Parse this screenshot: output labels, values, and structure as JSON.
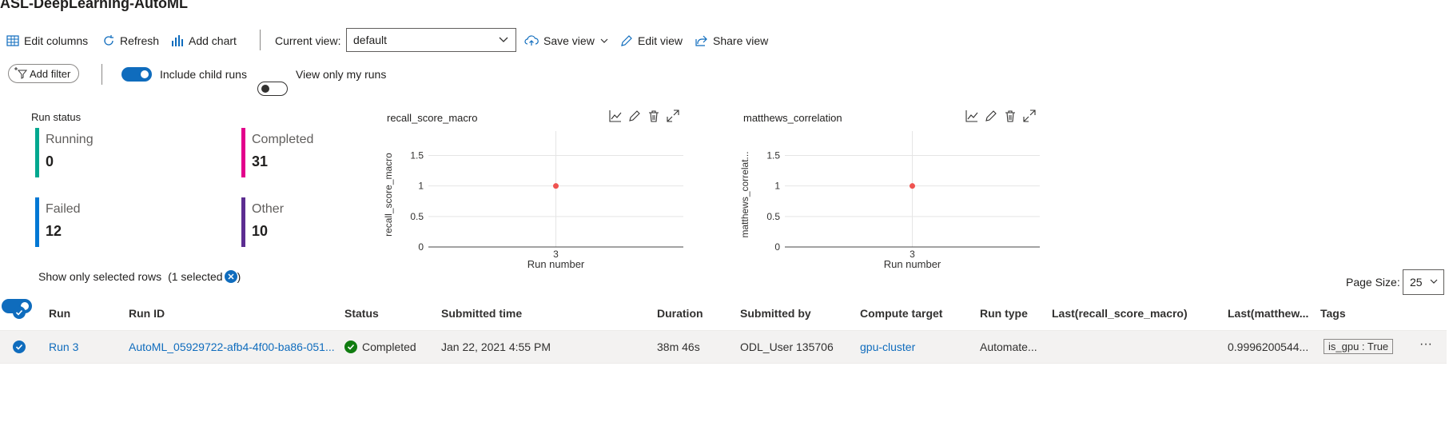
{
  "page": {
    "title": "ASL-DeepLearning-AutoML"
  },
  "toolbar": {
    "edit_columns": "Edit columns",
    "refresh": "Refresh",
    "add_chart": "Add chart",
    "current_view_label": "Current view:",
    "current_view_value": "default",
    "save_view": "Save view",
    "edit_view": "Edit view",
    "share_view": "Share view"
  },
  "filters": {
    "add_filter": "Add filter",
    "include_child_runs": "Include child runs",
    "include_child_runs_on": true,
    "view_only_my_runs": "View only my runs",
    "view_only_my_runs_on": false
  },
  "run_status": {
    "title": "Run status",
    "items": [
      {
        "label": "Running",
        "value": "0",
        "color": "#00a88f"
      },
      {
        "label": "Completed",
        "value": "31",
        "color": "#e3008c"
      },
      {
        "label": "Failed",
        "value": "12",
        "color": "#0078d4"
      },
      {
        "label": "Other",
        "value": "10",
        "color": "#5c2d91"
      }
    ]
  },
  "charts": [
    {
      "title": "recall_score_macro",
      "ylabel": "recall_score_macro",
      "xlabel": "Run number"
    },
    {
      "title": "matthews_correlation",
      "ylabel": "matthews_correlat...",
      "xlabel": "Run number"
    }
  ],
  "chart_data": [
    {
      "type": "scatter",
      "title": "recall_score_macro",
      "xlabel": "Run number",
      "ylabel": "recall_score_macro",
      "x": [
        3
      ],
      "y": [
        1
      ],
      "yticks": [
        "1.5",
        "1",
        "0.5",
        "0"
      ],
      "xticks": [
        "3"
      ],
      "ylim": [
        0,
        1.9
      ],
      "grid": true,
      "color": "#ef5350"
    },
    {
      "type": "scatter",
      "title": "matthews_correlation",
      "xlabel": "Run number",
      "ylabel": "matthews_correlat...",
      "x": [
        3
      ],
      "y": [
        1
      ],
      "yticks": [
        "1.5",
        "1",
        "0.5",
        "0"
      ],
      "xticks": [
        "3"
      ],
      "ylim": [
        0,
        1.9
      ],
      "grid": true,
      "color": "#ef5350"
    }
  ],
  "selection": {
    "show_selected_label": "Show only selected rows",
    "selected_count": "(1 selected",
    "close_paren": ")",
    "page_size_label": "Page Size:",
    "page_size_value": "25"
  },
  "table": {
    "headers": {
      "run": "Run",
      "run_id": "Run ID",
      "status": "Status",
      "submitted_time": "Submitted time",
      "duration": "Duration",
      "submitted_by": "Submitted by",
      "compute_target": "Compute target",
      "run_type": "Run type",
      "last_recall": "Last(recall_score_macro)",
      "last_matthews": "Last(matthew...",
      "tags": "Tags"
    },
    "rows": [
      {
        "run": "Run 3",
        "run_id": "AutoML_05929722-afb4-4f00-ba86-051...",
        "status": "Completed",
        "submitted_time": "Jan 22, 2021 4:55 PM",
        "duration": "38m 46s",
        "submitted_by": "ODL_User 135706",
        "compute_target": "gpu-cluster",
        "run_type": "Automate...",
        "last_recall": "",
        "last_matthews": "0.9996200544...",
        "tags": "is_gpu : True",
        "more": "···"
      }
    ]
  }
}
